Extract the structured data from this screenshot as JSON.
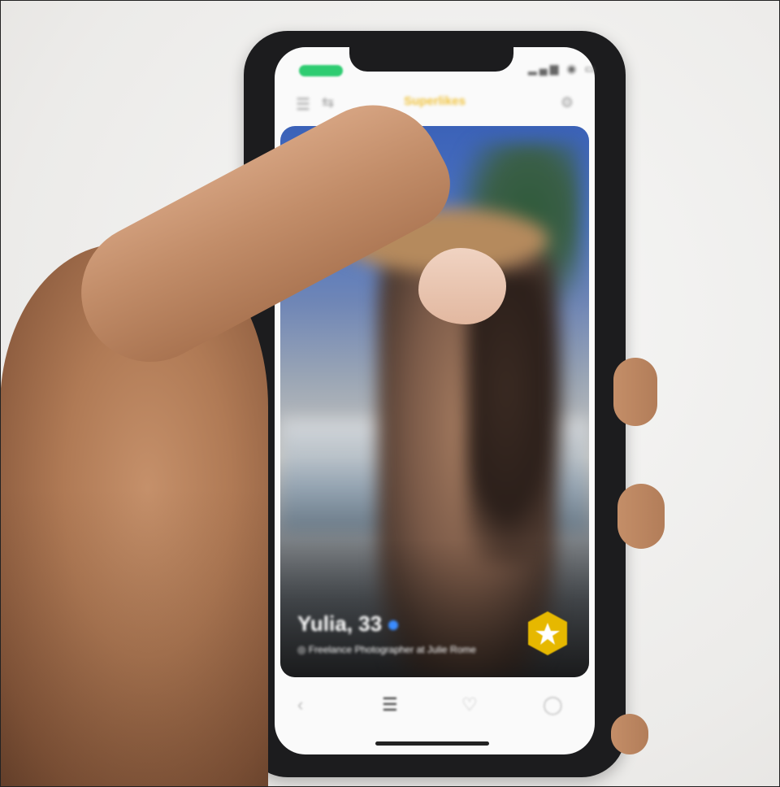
{
  "app": {
    "title": "Superlikes"
  },
  "profile": {
    "name_age": "Yulia, 33",
    "job": "Freelance Photographer at Julie Rome"
  },
  "tabs": [
    {
      "name": "tab-back"
    },
    {
      "name": "tab-discover"
    },
    {
      "name": "tab-likes"
    },
    {
      "name": "tab-chats"
    }
  ],
  "colors": {
    "accent": "#f0c23b",
    "badge": "#e6b800",
    "status_green": "#2ecc71",
    "verified_blue": "#3b8cff"
  }
}
